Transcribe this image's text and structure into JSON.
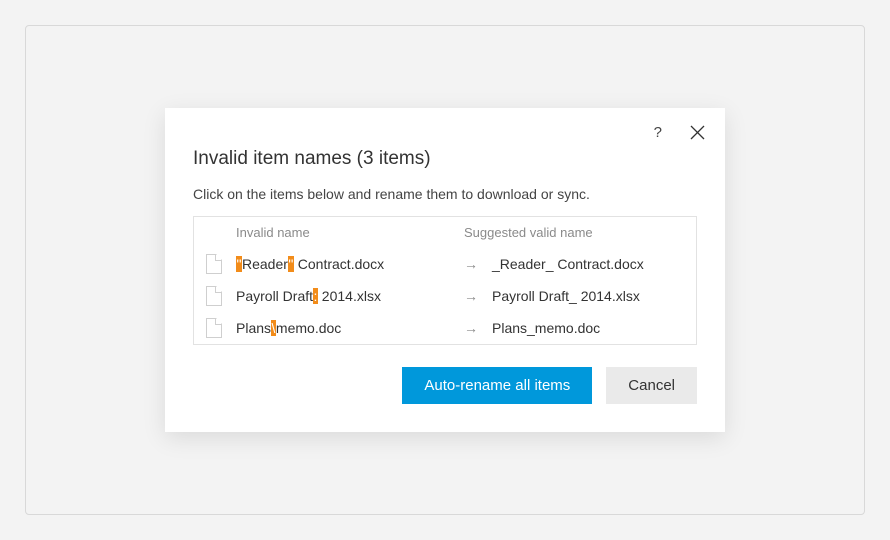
{
  "dialog": {
    "help_label": "?",
    "title": "Invalid item names (3 items)",
    "subtitle": "Click on the items below and rename them to download or sync.",
    "columns": {
      "invalid": "Invalid name",
      "suggested": "Suggested valid name"
    },
    "arrow": "→",
    "items": [
      {
        "invalid_parts": [
          "\"",
          "Reader",
          "\"",
          " Contract.docx"
        ],
        "highlight": [
          0,
          2
        ],
        "suggested": "_Reader_ Contract.docx"
      },
      {
        "invalid_parts": [
          "Payroll Draft",
          ":",
          " 2014.xlsx"
        ],
        "highlight": [
          1
        ],
        "suggested": "Payroll Draft_ 2014.xlsx"
      },
      {
        "invalid_parts": [
          "Plans",
          "\\",
          "memo.doc"
        ],
        "highlight": [
          1
        ],
        "suggested": "Plans_memo.doc"
      }
    ],
    "buttons": {
      "primary": "Auto-rename all items",
      "cancel": "Cancel"
    }
  }
}
